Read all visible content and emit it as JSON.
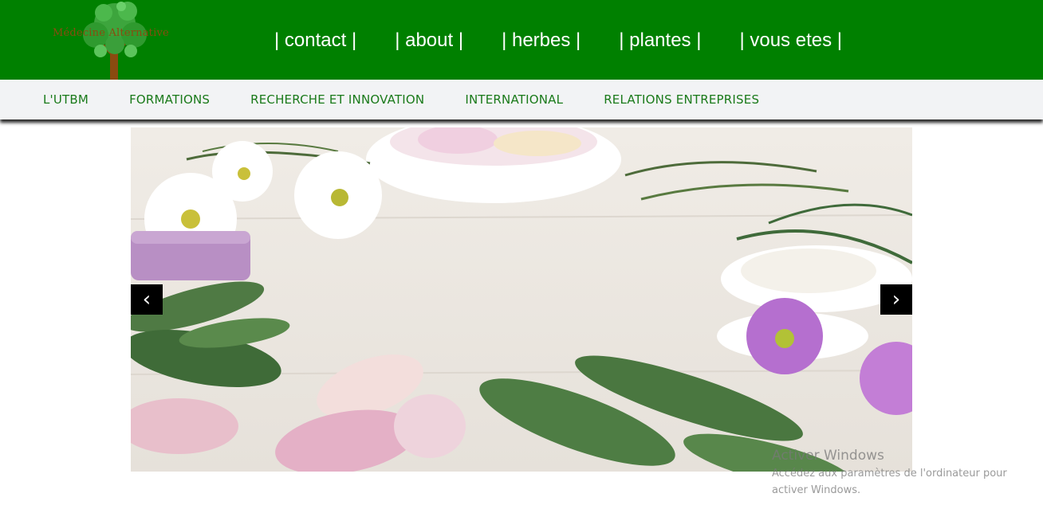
{
  "header": {
    "logo_text": "Médecine Alternative",
    "nav": [
      {
        "label": "| contact |"
      },
      {
        "label": "| about |"
      },
      {
        "label": "| herbes |"
      },
      {
        "label": "| plantes |"
      },
      {
        "label": "| vous etes |"
      }
    ]
  },
  "subnav": {
    "items": [
      {
        "label": "L'UTBM"
      },
      {
        "label": "FORMATIONS"
      },
      {
        "label": "RECHERCHE ET INNOVATION"
      },
      {
        "label": "INTERNATIONAL"
      },
      {
        "label": "RELATIONS ENTREPRISES"
      }
    ]
  },
  "carousel": {
    "prev_label": "‹",
    "next_label": "›"
  },
  "watermark": {
    "title": "Activer Windows",
    "subtitle": "Accédez aux paramètres de l'ordinateur pour activer Windows."
  },
  "colors": {
    "header_bg": "#008000",
    "subnav_bg": "#f2f3f5",
    "subnav_text": "#1a7a1a"
  }
}
